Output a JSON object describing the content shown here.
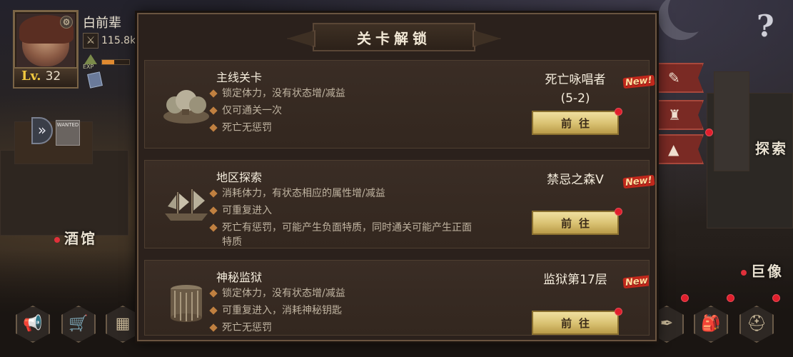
{
  "player": {
    "name": "白前辈",
    "level_label": "Lv.",
    "level": "32",
    "power": "115.8k",
    "exp_label": "EXP",
    "exp_progress": 0.45
  },
  "left_ui": {
    "wanted_label": "WANTED"
  },
  "locations": {
    "tavern": "酒馆",
    "explore": "探索",
    "statue": "巨像"
  },
  "modal": {
    "title": "关卡解锁",
    "entries": [
      {
        "title": "主线关卡",
        "bullets": [
          "锁定体力，没有状态增/减益",
          "仅可通关一次",
          "死亡无惩罚"
        ],
        "target_line1": "死亡咏唱者",
        "target_line2": "(5-2)",
        "badge": "New!",
        "button": "前往",
        "icon": "forest-island-icon"
      },
      {
        "title": "地区探索",
        "bullets": [
          "消耗体力，有状态相应的属性增/减益",
          "可重复进入",
          "死亡有惩罚，可能产生负面特质，同时通关可能产生正面特质"
        ],
        "target_line1": "禁忌之森V",
        "target_line2": "",
        "badge": "New!",
        "button": "前往",
        "icon": "sailing-ship-icon"
      },
      {
        "title": "神秘监狱",
        "bullets": [
          "锁定体力，没有状态增/减益",
          "可重复进入，消耗神秘钥匙",
          "死亡无惩罚"
        ],
        "target_line1": "监狱第17层",
        "target_line2": "",
        "badge": "New!",
        "button": "前往",
        "icon": "prison-tower-icon"
      }
    ]
  },
  "colors": {
    "accent_gold": "#d8c070",
    "notify_red": "#e01f2c",
    "ribbon_red": "#7a2a24"
  },
  "icons": {
    "help": "?",
    "expand": "»"
  }
}
